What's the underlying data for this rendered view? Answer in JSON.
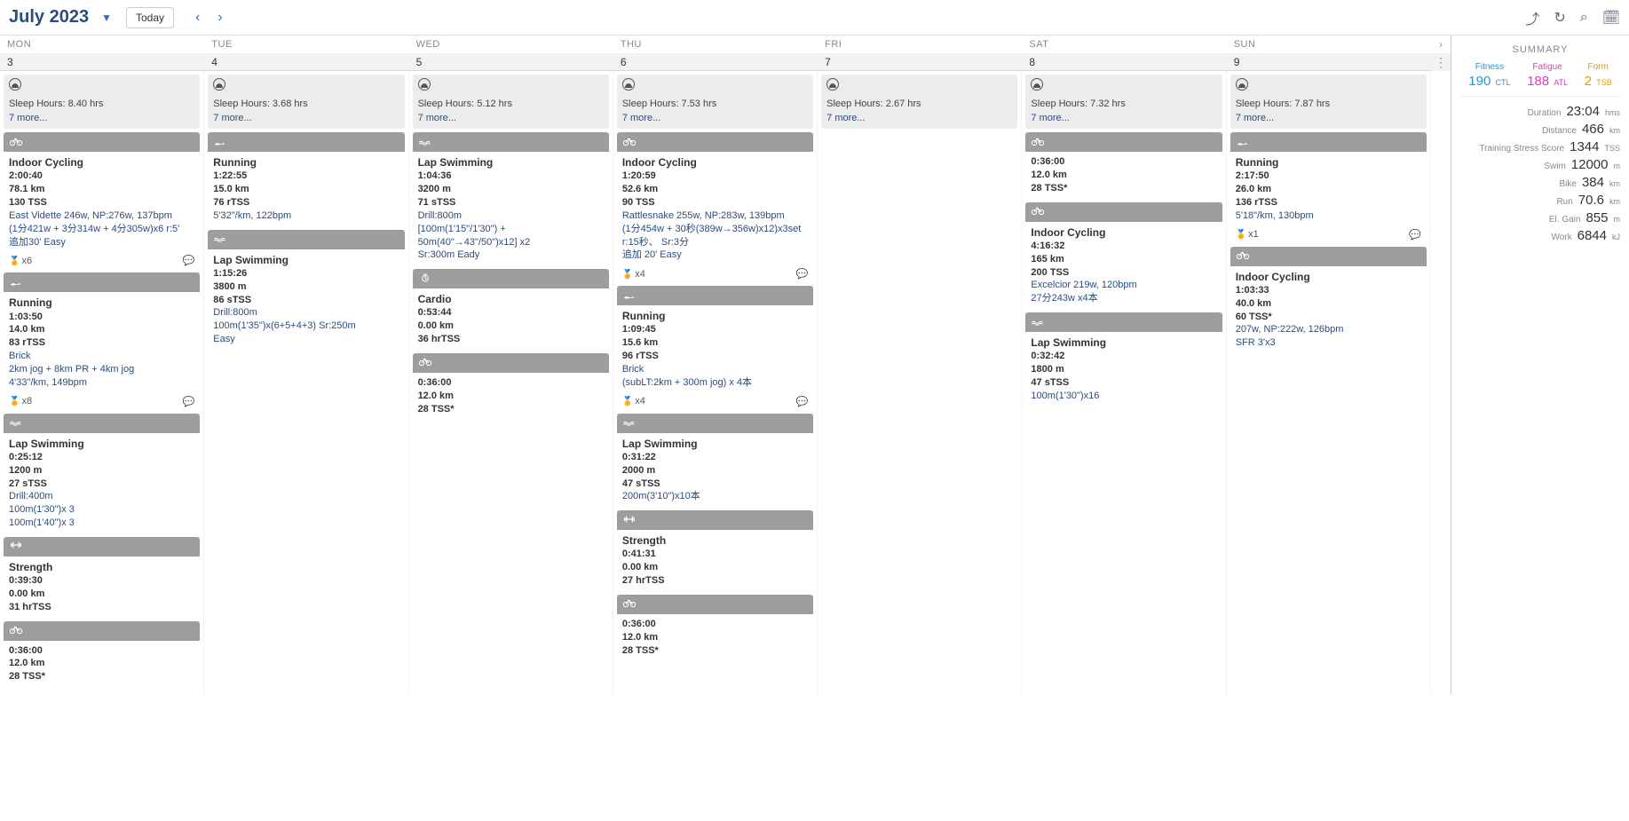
{
  "header": {
    "month": "July 2023",
    "today": "Today"
  },
  "dow": [
    "MON",
    "TUE",
    "WED",
    "THU",
    "FRI",
    "SAT",
    "SUN"
  ],
  "dates": [
    "3",
    "4",
    "5",
    "6",
    "7",
    "8",
    "9"
  ],
  "summary": {
    "title": "SUMMARY",
    "fit_lbl": "Fitness",
    "fit_val": "190",
    "fit_u": "CTL",
    "fat_lbl": "Fatigue",
    "fat_val": "188",
    "fat_u": "ATL",
    "form_lbl": "Form",
    "form_val": "2",
    "form_u": "TSB",
    "rows": [
      {
        "l": "Duration",
        "v": "23:04",
        "u": "hms"
      },
      {
        "l": "Distance",
        "v": "466",
        "u": "km"
      },
      {
        "l": "Training Stress Score",
        "v": "1344",
        "u": "TSS"
      },
      {
        "l": "Swim",
        "v": "12000",
        "u": "m"
      },
      {
        "l": "Bike",
        "v": "384",
        "u": "km"
      },
      {
        "l": "Run",
        "v": "70.6",
        "u": "km"
      },
      {
        "l": "El. Gain",
        "v": "855",
        "u": "m"
      },
      {
        "l": "Work",
        "v": "6844",
        "u": "kJ"
      }
    ]
  },
  "days": [
    {
      "sleep": "Sleep Hours: 8.40 hrs",
      "more": "7 more...",
      "cards": [
        {
          "sport": "bike",
          "title": "Indoor Cycling",
          "l1": "2:00:40",
          "l2": "78.1 km",
          "l3": "130 TSS",
          "d1": "East Vidette 246w, NP:276w, 137bpm",
          "d2": "(1分421w + 3分314w + 4分305w)x6 r:5'",
          "d3": "追加30'   Easy",
          "footer": {
            "a": "x6",
            "c": true
          }
        },
        {
          "sport": "run",
          "title": "Running",
          "l1": "1:03:50",
          "l2": "14.0 km",
          "l3": "83 rTSS",
          "d1": "Brick",
          "d2": "2km jog + 8km PR + 4km jog",
          "d3": "4'33\"/km, 149bpm",
          "footer": {
            "a": "x8",
            "c": true
          }
        },
        {
          "sport": "swim",
          "title": "Lap Swimming",
          "l1": "0:25:12",
          "l2": "1200 m",
          "l3": "27 sTSS",
          "d1": "Drill:400m",
          "d2": "100m(1'30\")x 3",
          "d3": "100m(1'40\")x 3"
        },
        {
          "sport": "strength",
          "title": "Strength",
          "l1": "0:39:30",
          "l2": "0.00 km",
          "l3": "31 hrTSS"
        },
        {
          "sport": "bike",
          "title": "",
          "l1": "0:36:00",
          "l2": "12.0 km",
          "l3": "28 TSS*"
        }
      ]
    },
    {
      "sleep": "Sleep Hours: 3.68 hrs",
      "more": "7 more...",
      "cards": [
        {
          "sport": "run",
          "title": "Running",
          "l1": "1:22:55",
          "l2": "15.0 km",
          "l3": "76 rTSS",
          "d1": "5'32\"/km, 122bpm"
        },
        {
          "sport": "swim",
          "title": "Lap Swimming",
          "l1": "1:15:26",
          "l2": "3800 m",
          "l3": "86 sTSS",
          "d1": "Drill:800m",
          "d2": "100m(1'35\")x(6+5+4+3) Sr:250m",
          "d3": "Easy"
        }
      ]
    },
    {
      "sleep": "Sleep Hours: 5.12 hrs",
      "more": "7 more...",
      "cards": [
        {
          "sport": "swim",
          "title": "Lap Swimming",
          "l1": "1:04:36",
          "l2": "3200 m",
          "l3": "71 sTSS",
          "d1": "Drill:800m",
          "d2": "[100m(1'15\"/1'30\") + 50m(40\"→43\"/50\")x12] x2",
          "d3": "Sr:300m Eady"
        },
        {
          "sport": "cardio",
          "title": "Cardio",
          "l1": "0:53:44",
          "l2": "0.00 km",
          "l3": "36 hrTSS"
        },
        {
          "sport": "bike",
          "title": "",
          "l1": "0:36:00",
          "l2": "12.0 km",
          "l3": "28 TSS*"
        }
      ]
    },
    {
      "sleep": "Sleep Hours: 7.53 hrs",
      "more": "7 more...",
      "cards": [
        {
          "sport": "bike",
          "title": "Indoor Cycling",
          "l1": "1:20:59",
          "l2": "52.6 km",
          "l3": "90 TSS",
          "d1": "Rattlesnake 255w, NP:283w, 139bpm",
          "d2": "(1分454w + 30秒(389w→356w)x12)x3set",
          "d3": "r:15秒、  Sr:3分",
          "d4": "追加   20' Easy",
          "footer": {
            "a": "x4",
            "c": true
          }
        },
        {
          "sport": "run",
          "title": "Running",
          "l1": "1:09:45",
          "l2": "15.6 km",
          "l3": "96 rTSS",
          "d1": "Brick",
          "d2": "(subLT:2km + 300m jog) x 4本",
          "footer": {
            "a": "x4",
            "c": true
          }
        },
        {
          "sport": "swim",
          "title": "Lap Swimming",
          "l1": "0:31:22",
          "l2": "2000 m",
          "l3": "47 sTSS",
          "d1": "200m(3'10\")x10本"
        },
        {
          "sport": "strength",
          "title": "Strength",
          "l1": "0:41:31",
          "l2": "0.00 km",
          "l3": "27 hrTSS"
        },
        {
          "sport": "bike",
          "title": "",
          "l1": "0:36:00",
          "l2": "12.0 km",
          "l3": "28 TSS*"
        }
      ]
    },
    {
      "sleep": "Sleep Hours: 2.67 hrs",
      "more": "7 more...",
      "cards": []
    },
    {
      "sleep": "Sleep Hours: 7.32 hrs",
      "more": "7 more...",
      "cards": [
        {
          "sport": "bike",
          "title": "",
          "l1": "0:36:00",
          "l2": "12.0 km",
          "l3": "28 TSS*"
        },
        {
          "sport": "bike",
          "title": "Indoor Cycling",
          "l1": "4:16:32",
          "l2": "165 km",
          "l3": "200 TSS",
          "d1": "Excelcior 219w, 120bpm",
          "d2": "27分243w x4本"
        },
        {
          "sport": "swim",
          "title": "Lap Swimming",
          "l1": "0:32:42",
          "l2": "1800 m",
          "l3": "47 sTSS",
          "d1": "100m(1'30\")x16"
        }
      ]
    },
    {
      "sleep": "Sleep Hours: 7.87 hrs",
      "more": "7 more...",
      "cards": [
        {
          "sport": "run",
          "title": "Running",
          "l1": "2:17:50",
          "l2": "26.0 km",
          "l3": "136 rTSS",
          "d1": "5'18\"/km, 130bpm",
          "footer": {
            "a": "x1",
            "c": true
          }
        },
        {
          "sport": "bike",
          "title": "Indoor Cycling",
          "l1": "1:03:33",
          "l2": "40.0 km",
          "l3": "60 TSS*",
          "d1": "207w, NP:222w, 126bpm",
          "d2": "SFR 3'x3"
        }
      ]
    }
  ]
}
